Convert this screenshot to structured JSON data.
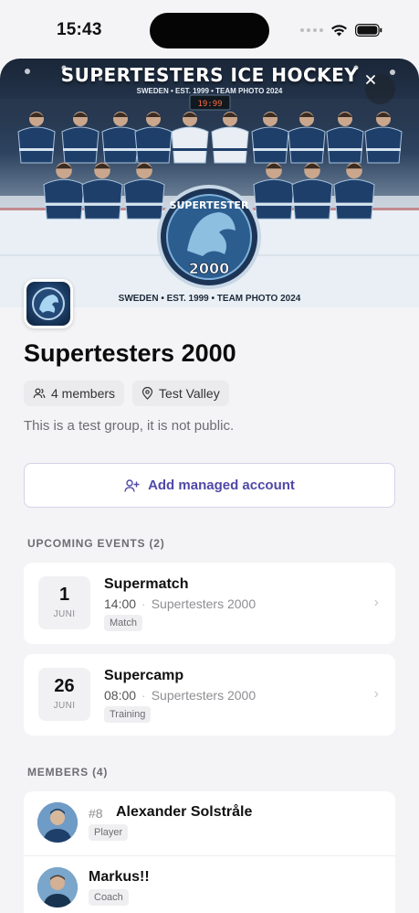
{
  "status_bar": {
    "time": "15:43"
  },
  "hero": {
    "title": "SUPERTESTERS ICE HOCKEY",
    "subtitle": "SWEDEN • EST. 1999 • TEAM PHOTO 2024",
    "bottom_caption": "SWEDEN • EST. 1999 • TEAM PHOTO 2024",
    "logo_text": "SUPERTESTER",
    "logo_year": "2000",
    "scoreboard": "19:99",
    "close_icon": "close-icon"
  },
  "group": {
    "name": "Supertesters 2000",
    "members_chip": "4 members",
    "location_chip": "Test Valley",
    "description": "This is a test group, it is not public."
  },
  "actions": {
    "add_managed_account": "Add managed account"
  },
  "events": {
    "section_label": "UPCOMING EVENTS (2)",
    "items": [
      {
        "day": "1",
        "month": "JUNI",
        "title": "Supermatch",
        "time": "14:00",
        "group": "Supertesters 2000",
        "tag": "Match"
      },
      {
        "day": "26",
        "month": "JUNI",
        "title": "Supercamp",
        "time": "08:00",
        "group": "Supertesters 2000",
        "tag": "Training"
      }
    ]
  },
  "members": {
    "section_label": "MEMBERS (4)",
    "items": [
      {
        "number": "#8",
        "name": "Alexander Solstråle",
        "role": "Player"
      },
      {
        "number": "",
        "name": "Markus!!",
        "role": "Coach"
      }
    ]
  },
  "colors": {
    "accent": "#4f48a8",
    "jersey": "#1f3f6b",
    "background": "#f4f4f6"
  }
}
